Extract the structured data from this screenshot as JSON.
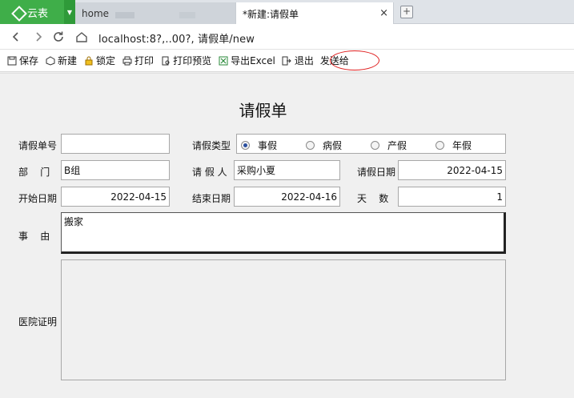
{
  "browser": {
    "app_name": "云表",
    "tabs": [
      {
        "label": "home"
      },
      {
        "label": "*新建:请假单",
        "close": "×"
      }
    ],
    "new_tab": "+",
    "url": "localhost:8?,..00?, 请假单/new"
  },
  "toolbar": {
    "items": [
      {
        "label": "保存",
        "icon": "save-icon"
      },
      {
        "label": "新建",
        "icon": "new-icon"
      },
      {
        "label": "锁定",
        "icon": "lock-icon"
      },
      {
        "label": "打印",
        "icon": "print-icon"
      },
      {
        "label": "打印预览",
        "icon": "print-preview-icon"
      },
      {
        "label": "导出Excel",
        "icon": "excel-icon"
      },
      {
        "label": "退出",
        "icon": "exit-icon"
      },
      {
        "label": "发送给"
      }
    ],
    "highlight_color": "#e02020"
  },
  "form": {
    "title": "请假单",
    "labels": {
      "leave_no": "请假单号",
      "leave_type": "请假类型",
      "dept": "部    门",
      "applicant": "请 假 人",
      "leave_date": "请假日期",
      "start_date": "开始日期",
      "end_date": "结束日期",
      "days": "天    数",
      "reason": "事    由",
      "proof": "医院证明"
    },
    "values": {
      "leave_no": "",
      "dept": "B组",
      "applicant": "采购小夏",
      "leave_date": "2022-04-15",
      "start_date": "2022-04-15",
      "end_date": "2022-04-16",
      "days": "1",
      "reason": "搬家"
    },
    "leave_types": [
      "事假",
      "病假",
      "产假",
      "年假"
    ],
    "selected_leave_type": "事假"
  },
  "colors": {
    "app_green": "#3fae49",
    "radio_selected": "#2a4f9e"
  }
}
